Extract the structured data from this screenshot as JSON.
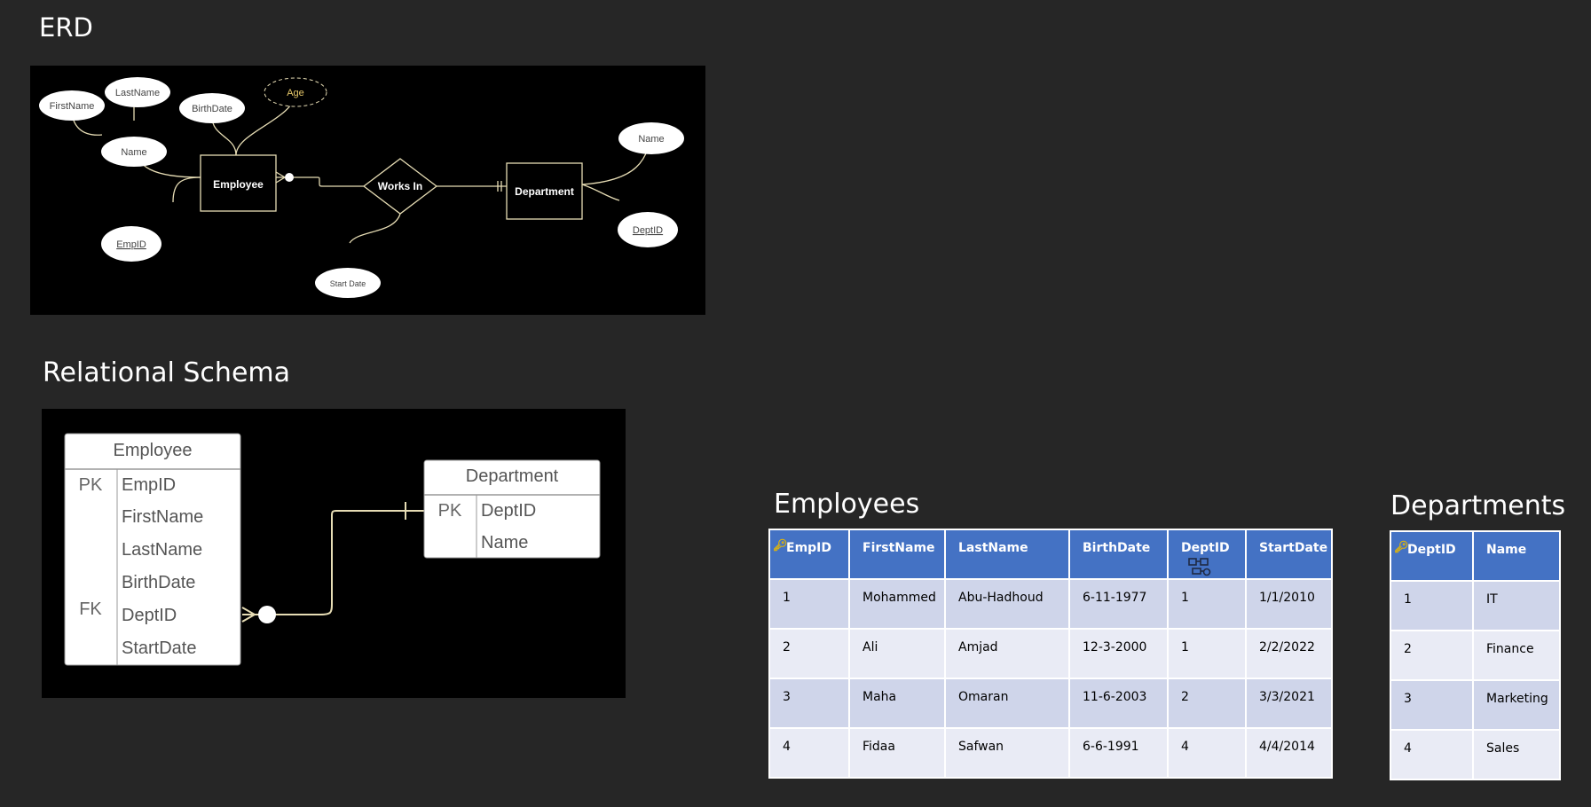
{
  "titles": {
    "erd": "ERD",
    "relational_schema": "Relational Schema",
    "employees": "Employees",
    "departments": "Departments"
  },
  "erd": {
    "entities": {
      "employee": "Employee",
      "department": "Department"
    },
    "relationship": "Works In",
    "attributes": {
      "first_name": "FirstName",
      "last_name": "LastName",
      "name": "Name",
      "birth_date": "BirthDate",
      "age": "Age",
      "emp_id": "EmpID",
      "start_date": "Start Date",
      "dept_name": "Name",
      "dept_id": "DeptID"
    }
  },
  "schema": {
    "employee": {
      "title": "Employee",
      "keys": [
        "PK",
        "",
        "",
        "",
        "FK",
        ""
      ],
      "fields": [
        "EmpID",
        "FirstName",
        "LastName",
        "BirthDate",
        "DeptID",
        "StartDate"
      ]
    },
    "department": {
      "title": "Department",
      "keys": [
        "PK",
        ""
      ],
      "fields": [
        "DeptID",
        "Name"
      ]
    }
  },
  "employees_table": {
    "headers": [
      "EmpID",
      "FirstName",
      "LastName",
      "BirthDate",
      "DeptID",
      "StartDate"
    ],
    "rows": [
      [
        "1",
        "Mohammed",
        "Abu-Hadhoud",
        "6-11-1977",
        "1",
        "1/1/2010"
      ],
      [
        "2",
        "Ali",
        "Amjad",
        "12-3-2000",
        "1",
        "2/2/2022"
      ],
      [
        "3",
        "Maha",
        "Omaran",
        "11-6-2003",
        "2",
        "3/3/2021"
      ],
      [
        "4",
        "Fidaa",
        "Safwan",
        "6-6-1991",
        "4",
        "4/4/2014"
      ]
    ]
  },
  "departments_table": {
    "headers": [
      "DeptID",
      "Name"
    ],
    "rows": [
      [
        "1",
        "IT"
      ],
      [
        "2",
        "Finance"
      ],
      [
        "3",
        "Marketing"
      ],
      [
        "4",
        "Sales"
      ]
    ]
  },
  "colors": {
    "table_header": "#4472c4",
    "row_odd": "#cfd5ea",
    "row_even": "#e9ebf5",
    "erd_line": "#e6dcb4",
    "age_text": "#e8c96a",
    "key_icon": "#e8b800"
  }
}
